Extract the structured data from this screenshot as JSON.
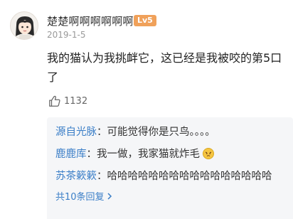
{
  "comment": {
    "username": "楚楚啊啊啊啊啊啊",
    "level_badge": "Lv5",
    "date": "2019-1-5",
    "text": "我的猫认为我挑衅它，这已经是我被咬的第5口了",
    "likes": "1132",
    "icons": {
      "avatar": "avatar-cartoon-girl",
      "like": "thumbs-up-icon",
      "reply_emoji": "angry-cat-emoji-icon",
      "more": "chevron-right-icon"
    }
  },
  "replies": [
    {
      "user": "源自光脉",
      "sep": "：",
      "text": "可能觉得你是只鸟。。。。"
    },
    {
      "user": "鹿鹿库",
      "sep": "：",
      "text": "我一做，我家猫就炸毛"
    },
    {
      "user": "苏茶簌簌",
      "sep": "：",
      "text": "哈哈哈哈哈哈哈哈哈哈哈哈哈哈哈哈"
    }
  ],
  "more_replies": "共10条回复",
  "colors": {
    "link": "#3a7ec7",
    "badge": "#f0a15a",
    "reply_bg": "#f5f6f8"
  }
}
